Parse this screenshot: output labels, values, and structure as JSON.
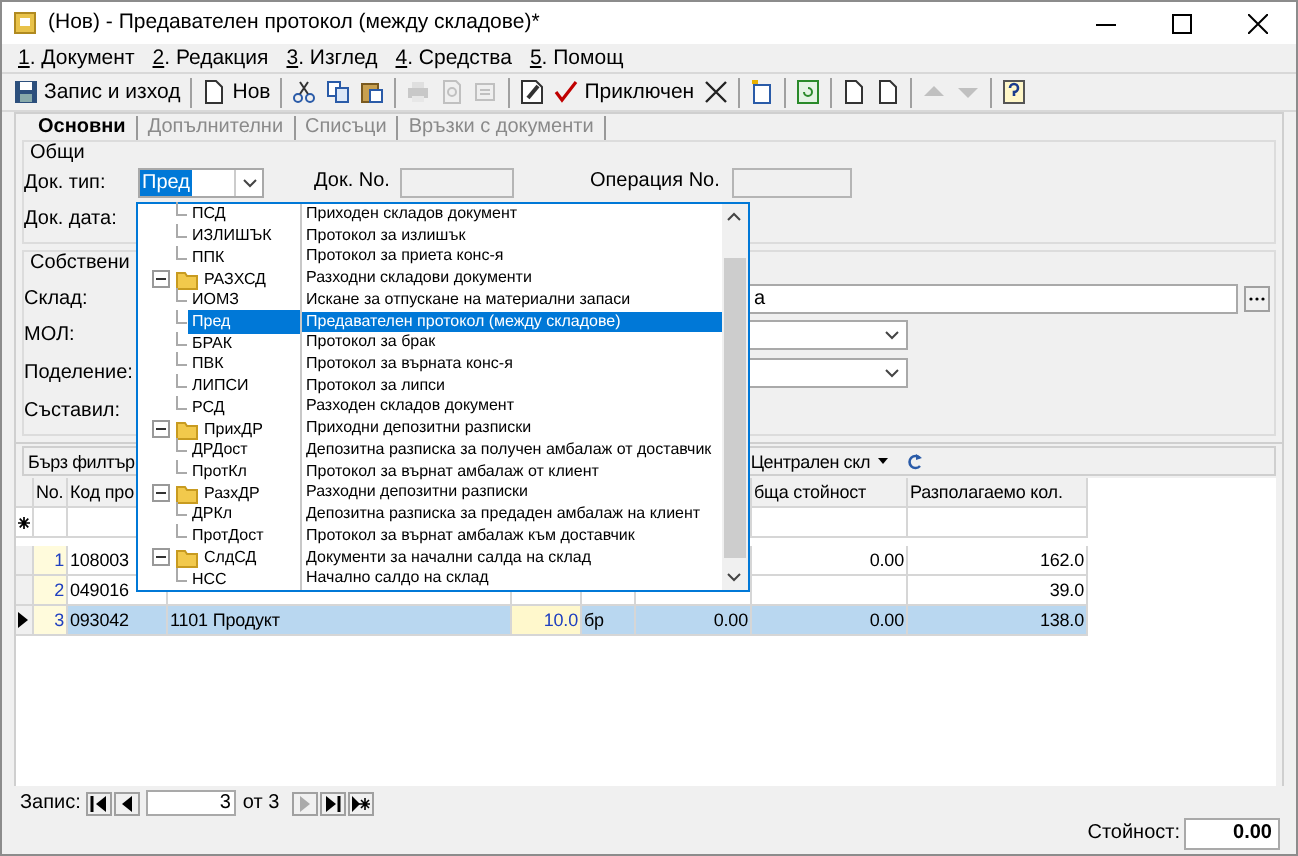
{
  "window": {
    "title": "(Нов) - Предавателен протокол (между складове)*"
  },
  "menu": [
    "1. Документ",
    "2. Редакция",
    "3. Изглед",
    "4. Средства",
    "5. Помощ"
  ],
  "toolbar": [
    {
      "kind": "button",
      "label": "Запис и изход",
      "disabled": false
    },
    {
      "kind": "separator"
    },
    {
      "kind": "button",
      "label": "Нов",
      "disabled": false
    },
    {
      "kind": "separator"
    },
    {
      "kind": "button",
      "disabled": false
    },
    {
      "kind": "button",
      "disabled": false
    },
    {
      "kind": "button",
      "disabled": false
    },
    {
      "kind": "separator"
    },
    {
      "kind": "button",
      "disabled": true
    },
    {
      "kind": "button",
      "disabled": true
    },
    {
      "kind": "button",
      "disabled": true
    },
    {
      "kind": "separator"
    },
    {
      "kind": "button",
      "disabled": false
    },
    {
      "kind": "button",
      "label": "Приключен",
      "disabled": false
    },
    {
      "kind": "button",
      "disabled": false
    },
    {
      "kind": "separator"
    },
    {
      "kind": "button",
      "disabled": false
    },
    {
      "kind": "separator"
    },
    {
      "kind": "button",
      "disabled": false
    },
    {
      "kind": "separator"
    },
    {
      "kind": "button",
      "disabled": false
    },
    {
      "kind": "button",
      "disabled": false
    },
    {
      "kind": "separator"
    },
    {
      "kind": "button",
      "disabled": true
    },
    {
      "kind": "button",
      "disabled": true
    },
    {
      "kind": "separator"
    },
    {
      "kind": "button",
      "disabled": false
    }
  ],
  "tabs": [
    {
      "label": "Основни",
      "selected": true
    },
    {
      "label": "Допълнителни",
      "selected": false
    },
    {
      "label": "Списъци",
      "selected": false
    },
    {
      "label": "Връзки с документи",
      "selected": false
    }
  ],
  "general": {
    "title": "Общи",
    "doc_type_label": "Док. тип:",
    "doc_type_value": "Пред",
    "doc_no_label": "Док. No.",
    "operation_no_label": "Операция No.",
    "doc_date_label": "Док. дата:"
  },
  "own": {
    "title": "Собствени",
    "warehouse_label": "Склад:",
    "warehouse_value": "а",
    "mol_label": "МОЛ:",
    "division_label": "Поделение:",
    "author_label": "Съставил:"
  },
  "grid": {
    "filter_button": "Бърз филтър",
    "warehouse_filter": "Централен скл",
    "columns": [
      "No.",
      "Код про",
      null,
      null,
      null,
      null,
      "бща стойност",
      "Разполагаемо кол."
    ],
    "rows": [
      {
        "cells": [
          "1",
          "108003",
          null,
          null,
          null,
          null,
          "0.00",
          "162.0"
        ],
        "selected": false
      },
      {
        "cells": [
          "2",
          "049016",
          null,
          null,
          null,
          null,
          null,
          "39.0"
        ],
        "selected": false
      },
      {
        "cells": [
          "3",
          "093042",
          "1101 Продукт",
          "10.0",
          "бр",
          "0.00",
          "0.00",
          "138.0"
        ],
        "selected": true
      }
    ]
  },
  "nav": {
    "label": "Запис:",
    "current": "3",
    "of": "от 3"
  },
  "footer": {
    "label": "Стойност:",
    "value": "0.00"
  },
  "dropdown": {
    "items": [
      {
        "code": "ПСД",
        "description": "Приходен складов документ",
        "selected": false
      },
      {
        "code": "ИЗЛИШЪК",
        "description": "Протокол за излишък",
        "selected": false
      },
      {
        "code": "ППК",
        "description": "Протокол за приета конс-я",
        "selected": false
      },
      {
        "code": "РАЗХСД",
        "description": "Разходни складови документи",
        "selected": false,
        "expanded": true,
        "children": [
          {
            "code": "ИОМЗ",
            "description": "Искане за отпускане на материални запаси",
            "selected": false
          },
          {
            "code": "Пред",
            "description": "Предавателен протокол (между складове)",
            "selected": true
          },
          {
            "code": "БРАК",
            "description": "Протокол за брак",
            "selected": false
          },
          {
            "code": "ПВК",
            "description": "Протокол за върната конс-я",
            "selected": false
          },
          {
            "code": "ЛИПСИ",
            "description": "Протокол за липси",
            "selected": false
          },
          {
            "code": "РСД",
            "description": "Разходен складов документ",
            "selected": false
          }
        ]
      },
      {
        "code": "ПрихДР",
        "description": "Приходни депозитни разписки",
        "selected": false,
        "expanded": true,
        "children": [
          {
            "code": "ДРДост",
            "description": "Депозитна разписка за получен амбалаж от доставчик",
            "selected": false
          },
          {
            "code": "ПротКл",
            "description": "Протокол за върнат амбалаж от клиент",
            "selected": false
          }
        ]
      },
      {
        "code": "РазхДР",
        "description": "Разходни депозитни разписки",
        "selected": false,
        "expanded": true,
        "children": [
          {
            "code": "ДРКл",
            "description": "Депозитна разписка за предаден амбалаж на клиент",
            "selected": false
          },
          {
            "code": "ПротДост",
            "description": "Протокол за върнат амбалаж към доставчик",
            "selected": false
          }
        ]
      },
      {
        "code": "СлдСД",
        "description": "Документи за начални салда на склад",
        "selected": false,
        "expanded": true,
        "children": [
          {
            "code": "НСС",
            "description": "Начално салдо на склад",
            "selected": false
          }
        ]
      }
    ]
  }
}
